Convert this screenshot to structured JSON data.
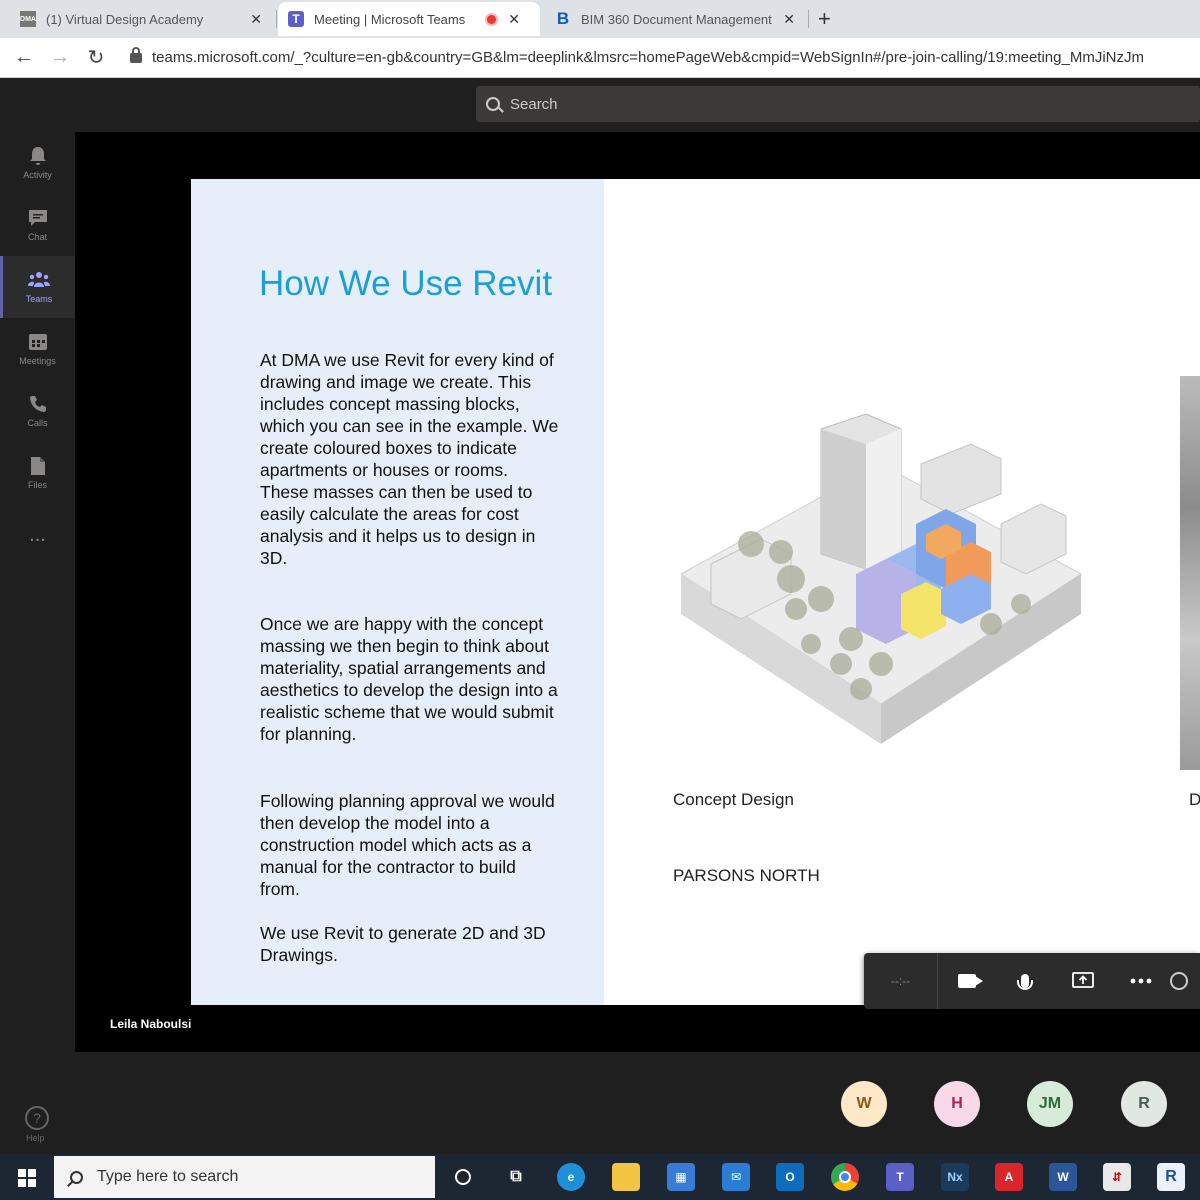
{
  "browser": {
    "tabs": [
      {
        "title": "(1) Virtual Design Academy",
        "icon": "dma-icon"
      },
      {
        "title": "Meeting | Microsoft Teams",
        "icon": "teams-icon",
        "recording": true
      },
      {
        "title": "BIM 360 Document Management",
        "icon": "bim360-icon"
      }
    ],
    "url": "teams.microsoft.com/_?culture=en-gb&country=GB&lm=deeplink&lmsrc=homePageWeb&cmpid=WebSignIn#/pre-join-calling/19:meeting_MmJiNzJm"
  },
  "teams": {
    "search_placeholder": "Search",
    "rail": [
      {
        "label": "Activity",
        "icon": "bell-icon"
      },
      {
        "label": "Chat",
        "icon": "chat-icon"
      },
      {
        "label": "Teams",
        "icon": "teams-people-icon",
        "active": true
      },
      {
        "label": "Meetings",
        "icon": "calendar-icon"
      },
      {
        "label": "Calls",
        "icon": "phone-icon"
      },
      {
        "label": "Files",
        "icon": "file-icon"
      }
    ],
    "rail_more": "...",
    "help_label": "Help",
    "presenter": "Leila Naboulsi",
    "controls": {
      "timer": "--:--"
    },
    "participants": [
      {
        "initials": "W",
        "bg": "#fde9c8",
        "fg": "#8a5a12"
      },
      {
        "initials": "H",
        "bg": "#f9d9e7",
        "fg": "#a3235c"
      },
      {
        "initials": "JM",
        "bg": "#d6ecd9",
        "fg": "#2e6b3a"
      },
      {
        "initials": "R",
        "bg": "#e1e8e2",
        "fg": "#4a5c4e"
      }
    ]
  },
  "slide": {
    "title": "How We Use Revit",
    "paragraphs": [
      "At DMA we use Revit for every kind of drawing and image we create. This includes concept massing blocks, which you can see in the example. We create coloured boxes to indicate apartments or houses or rooms. These masses can then be used to easily calculate the areas for cost analysis and it helps us to design in 3D.",
      "Once we are happy with the concept massing we then begin to think about materiality, spatial arrangements and aesthetics to develop the design into a realistic scheme that we would submit for planning.",
      "Following planning approval we would then develop the model into a construction model which acts as a manual for the contractor to build from.",
      "We use Revit to generate 2D and 3D Drawings."
    ],
    "caption": "Concept Design",
    "project": "PARSONS NORTH",
    "caption_cut": "D"
  },
  "taskbar": {
    "search_placeholder": "Type here to search"
  },
  "colors": {
    "accent": "#1a9fd6",
    "teams_purple": "#6264a7",
    "slide_panel": "#e6eff9"
  }
}
